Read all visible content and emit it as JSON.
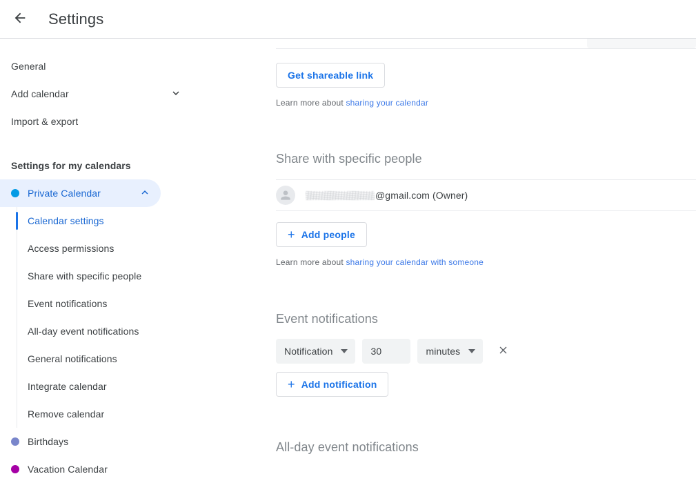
{
  "header": {
    "back_icon": "arrow-back-icon",
    "title": "Settings"
  },
  "sidebar": {
    "top_items": [
      {
        "label": "General",
        "icon": null
      },
      {
        "label": "Add calendar",
        "icon": "chevron-down-icon"
      },
      {
        "label": "Import & export",
        "icon": null
      }
    ],
    "my_calendars_heading": "Settings for my calendars",
    "calendars": [
      {
        "label": "Private Calendar",
        "dot_color": "#039be5",
        "selected": true,
        "expanded": true,
        "expand_icon": "chevron-up-icon",
        "sub_items": [
          {
            "label": "Calendar settings",
            "active": true
          },
          {
            "label": "Access permissions",
            "active": false
          },
          {
            "label": "Share with specific people",
            "active": false
          },
          {
            "label": "Event notifications",
            "active": false
          },
          {
            "label": "All-day event notifications",
            "active": false
          },
          {
            "label": "General notifications",
            "active": false
          },
          {
            "label": "Integrate calendar",
            "active": false
          },
          {
            "label": "Remove calendar",
            "active": false
          }
        ]
      },
      {
        "label": "Birthdays",
        "dot_color": "#7986cb",
        "selected": false,
        "expanded": false,
        "sub_items": []
      },
      {
        "label": "Vacation Calendar",
        "dot_color": "#a500a5",
        "selected": false,
        "expanded": false,
        "sub_items": []
      }
    ]
  },
  "main": {
    "shareable_link_button": "Get shareable link",
    "learn_more_sharing": {
      "prefix": "Learn more about ",
      "link": "sharing your calendar"
    },
    "share_people": {
      "title": "Share with specific people",
      "person": {
        "avatar_icon": "person-avatar-icon",
        "username_redacted": true,
        "email_domain": "@gmail.com (Owner)"
      },
      "add_people_button": "Add people",
      "add_icon": "plus-icon",
      "learn_more": {
        "prefix": "Learn more about ",
        "link": "sharing your calendar with someone"
      }
    },
    "event_notifications": {
      "title": "Event notifications",
      "rows": [
        {
          "type_value": "Notification",
          "type_caret": "caret-down-icon",
          "amount_value": "30",
          "amount_placeholder": "30",
          "unit_value": "minutes",
          "unit_caret": "caret-down-icon",
          "remove_icon": "close-icon"
        }
      ],
      "add_notification_button": "Add notification",
      "add_icon": "plus-icon"
    },
    "all_day_event_notifications": {
      "title": "All-day event notifications"
    }
  },
  "colors": {
    "accent_blue": "#1a73e8",
    "link_blue": "#3b78e7",
    "selected_pill": "#e8f0fe",
    "field_gray": "#f1f3f4",
    "divider": "#e8eaed",
    "text_primary": "#3c4043",
    "text_secondary": "#5f6368",
    "heading_gray": "#80868b"
  }
}
